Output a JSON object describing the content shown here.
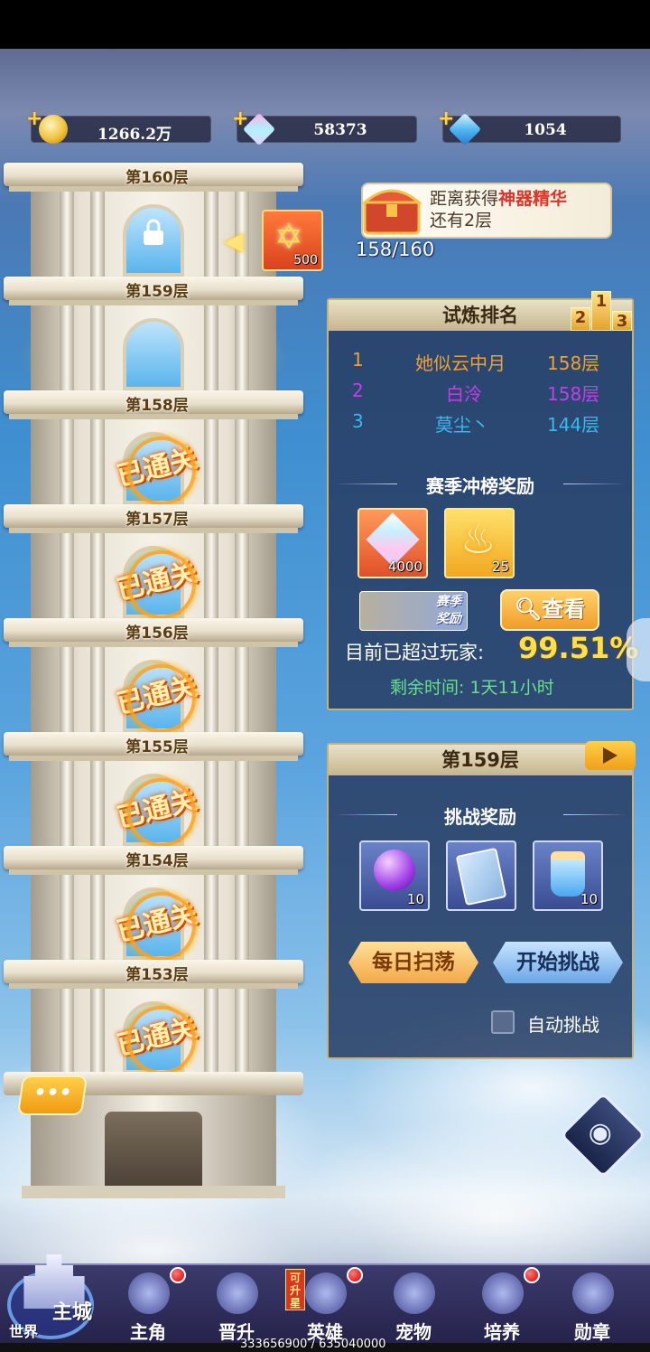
{
  "currencies": [
    {
      "name": "gold-coin",
      "value": "1266.2万"
    },
    {
      "name": "rainbow-crystal",
      "value": "58373"
    },
    {
      "name": "blue-diamond",
      "value": "1054"
    }
  ],
  "tower": {
    "floors": [
      {
        "label": "第160层",
        "state": "locked"
      },
      {
        "label": "第159层",
        "state": "current"
      },
      {
        "label": "第158层",
        "state": "cleared"
      },
      {
        "label": "第157层",
        "state": "cleared"
      },
      {
        "label": "第156层",
        "state": "cleared"
      },
      {
        "label": "第155层",
        "state": "cleared"
      },
      {
        "label": "第154层",
        "state": "cleared"
      },
      {
        "label": "第153层",
        "state": "cleared"
      }
    ],
    "cleared_stamp": "已通关",
    "floor_reward_count": "500",
    "chat_button": "•••"
  },
  "artifact_progress": {
    "line1_prefix": "距离获得",
    "line1_highlight": "神器精华",
    "line2": "还有2层",
    "progress": "158/160"
  },
  "ranking": {
    "title": "试炼排名",
    "podium": [
      "2",
      "1",
      "3"
    ],
    "rows": [
      {
        "rank": "1",
        "name": "她似云中月",
        "floor": "158层",
        "color": "#f0a030"
      },
      {
        "rank": "2",
        "name": "白泠",
        "floor": "158层",
        "color": "#c040e8"
      },
      {
        "rank": "3",
        "name": "莫尘丶",
        "floor": "144层",
        "color": "#38b8ee"
      }
    ],
    "season_title": "赛季冲榜奖励",
    "season_items": [
      {
        "name": "rainbow-crystal",
        "count": "4000"
      },
      {
        "name": "flame-essence",
        "count": "25"
      }
    ],
    "season_banner": "赛季\n奖励",
    "view_button": "查看",
    "beat_label": "目前已超过玩家:",
    "beat_percent": "99.51%",
    "remaining": "剩余时间: 1天11小时"
  },
  "challenge": {
    "title": "第159层",
    "reward_title": "挑战奖励",
    "items": [
      {
        "name": "purple-orb",
        "count": "10"
      },
      {
        "name": "rune-card",
        "count": ""
      },
      {
        "name": "potion-bottle",
        "count": "10"
      }
    ],
    "sweep_button": "每日扫荡",
    "start_button": "开始挑战",
    "auto_label": "自动挑战"
  },
  "nav": {
    "main_city": "主城",
    "world": "世界",
    "items": [
      {
        "label": "主角",
        "dot": true,
        "tag": ""
      },
      {
        "label": "晋升",
        "dot": false,
        "tag": ""
      },
      {
        "label": "英雄",
        "dot": true,
        "tag": "可升星"
      },
      {
        "label": "宠物",
        "dot": false,
        "tag": ""
      },
      {
        "label": "培养",
        "dot": true,
        "tag": ""
      },
      {
        "label": "勋章",
        "dot": false,
        "tag": ""
      }
    ]
  },
  "footer": "333656900 / 635040000"
}
